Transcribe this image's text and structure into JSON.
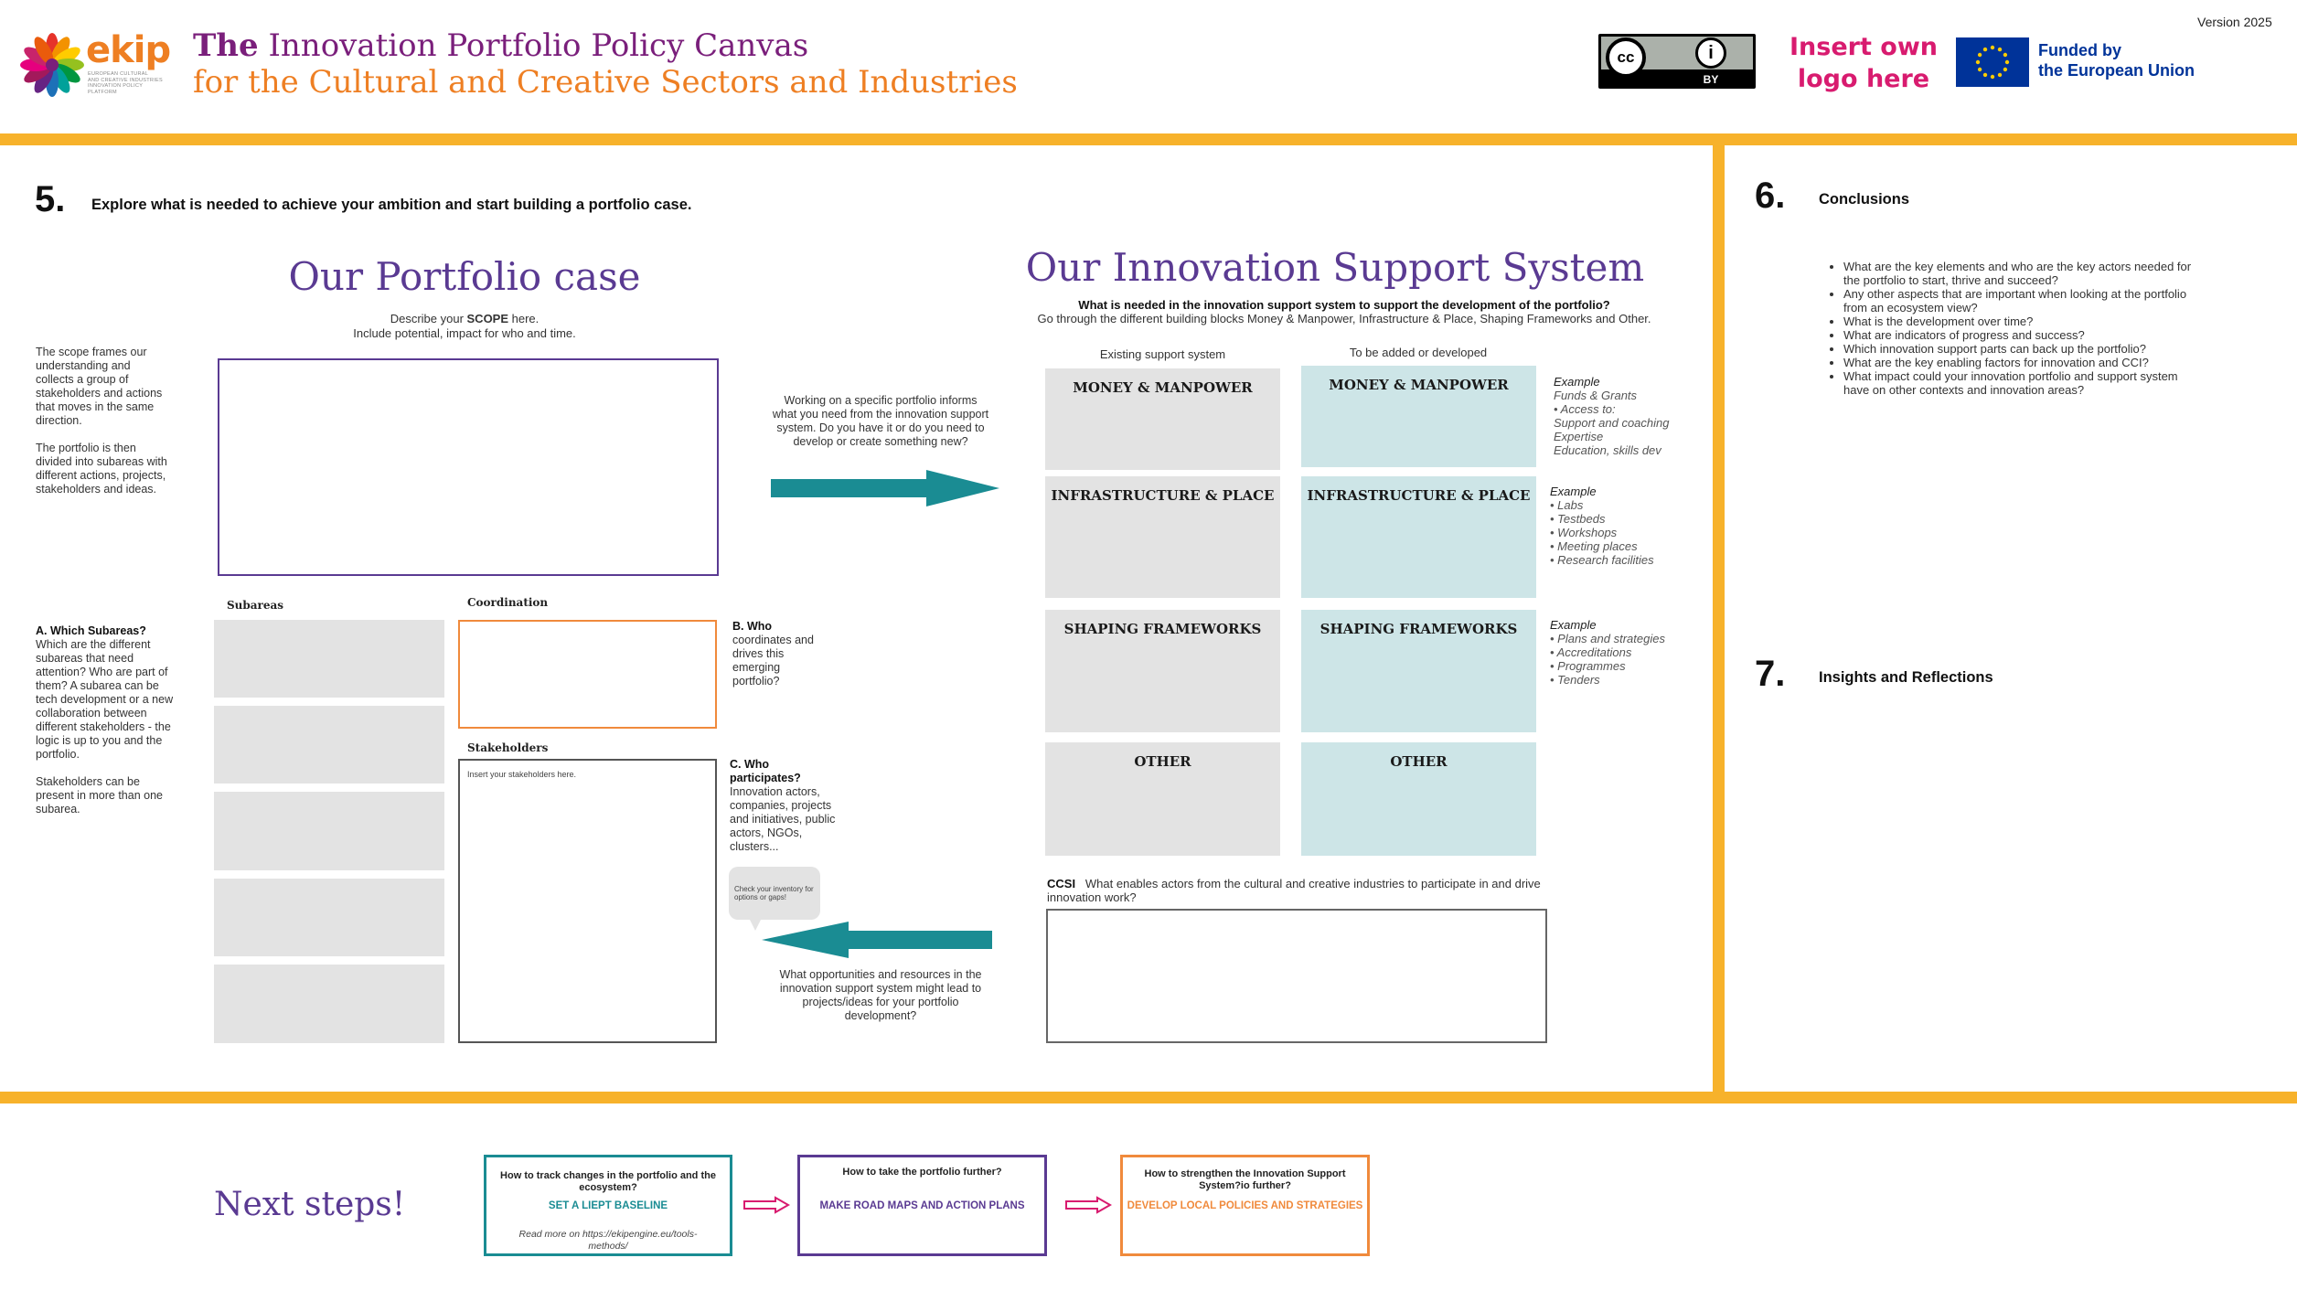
{
  "version": "Version 2025",
  "logo": {
    "name": "ekip",
    "tagline_lines": [
      "EUROPEAN CULTURAL",
      "AND CREATIVE INDUSTRIES",
      "INNOVATION POLICY PLATFORM"
    ]
  },
  "title": {
    "the": "The",
    "line1": "Innovation Portfolio Policy Canvas",
    "line2": "for the Cultural and Creative Sectors and Industries"
  },
  "license": {
    "label": "BY"
  },
  "own_logo": {
    "line1": "Insert own",
    "line2": "logo here"
  },
  "eu": {
    "line1": "Funded by",
    "line2": "the European Union"
  },
  "colors": {
    "yellow": "#F7B22B",
    "purple": "#5A3A92",
    "orange": "#F08A3C",
    "teal": "#1A8C93",
    "magenta": "#D81B6F",
    "title_purple": "#7A1F7B",
    "title_orange": "#EE7F23"
  },
  "section5": {
    "number": "5.",
    "heading": "Explore what is needed to achieve your ambition and start building a portfolio case.",
    "portfolio_title": "Our Portfolio case",
    "scope_pre": "Describe your ",
    "scope_bold": "SCOPE",
    "scope_post": " here.",
    "scope_line2": "Include potential, impact for who and time.",
    "left_text_1": "The scope frames our understanding and collects a group of stakeholders and actions that moves in the same direction.",
    "left_text_2": "The portfolio is then divided into subareas with different actions, projects, stakeholders and ideas.",
    "subareas_q_title": "A. Which Subareas?",
    "subareas_q_text": "Which are the different subareas that need attention? Who are part of them? A subarea can be tech development or a new collaboration between different stakeholders - the logic is up to you and the portfolio.",
    "subareas_q_text2": "Stakeholders can be present in more than one subarea.",
    "subareas_label": "Subareas",
    "coordination_label": "Coordination",
    "stakeholders_label": "Stakeholders",
    "stakeholders_placeholder": "Insert your stakeholders here.",
    "who_coord_title": "B. Who",
    "who_coord_text": "coordinates and drives this emerging portfolio?",
    "who_part_title": "C. Who participates?",
    "who_part_text": "Innovation actors, companies, projects and initiatives, public actors, NGOs, clusters...",
    "bubble": "Check your inventory for options or gaps!",
    "arrow_right_text": "Working on a specific portfolio informs what you need from the innovation support system.  Do you have it or do you need to develop or create something new?",
    "arrow_left_text": "What opportunities and resources in the innovation support system might lead to projects/ideas for your portfolio development?"
  },
  "iss": {
    "title": "Our Innovation Support System",
    "subtitle_bold": "What is needed in the innovation support system to support the development of the portfolio?",
    "subtitle": "Go through the different building blocks Money & Manpower, Infrastructure & Place, Shaping Frameworks and Other.",
    "col_existing": "Existing support system",
    "col_added": "To be added or developed",
    "blocks": [
      {
        "label": "MONEY & MANPOWER",
        "example_title": "Example",
        "example_lines": [
          "Funds & Grants",
          "• Access to:",
          "Support and coaching",
          "Expertise",
          "Education, skills dev"
        ]
      },
      {
        "label": "INFRASTRUCTURE & PLACE",
        "example_title": "Example",
        "example_lines": [
          "• Labs",
          "• Testbeds",
          "• Workshops",
          "• Meeting places",
          "• Research facilities"
        ]
      },
      {
        "label": "SHAPING FRAMEWORKS",
        "example_title": "Example",
        "example_lines": [
          "• Plans and strategies",
          "• Accreditations",
          "• Programmes",
          "• Tenders"
        ]
      },
      {
        "label": "OTHER",
        "example_title": "",
        "example_lines": []
      }
    ],
    "ccsi_label": "CCSI",
    "ccsi_text": "What enables actors from the cultural and creative industries to participate in and drive innovation work?"
  },
  "section6": {
    "number": "6.",
    "heading": "Conclusions",
    "bullets": [
      "What are the key elements and who are the key actors needed for the portfolio to start, thrive and succeed?",
      "Any other aspects that are important when looking at the portfolio from an ecosystem view?",
      "What is the development over time?",
      "What are indicators of progress and success?",
      "Which innovation support parts can back up the portfolio?",
      "What are the key enabling factors for innovation and CCI?",
      "What impact could your innovation portfolio and support system have on other contexts and innovation areas?"
    ]
  },
  "section7": {
    "number": "7.",
    "heading": "Insights and Reflections"
  },
  "next_steps": {
    "title": "Next steps!",
    "steps": [
      {
        "question": "How to track changes in the portfolio and the ecosystem?",
        "action": "SET A LIEPT BASELINE",
        "note": "Read more on https://ekipengine.eu/tools-methods/"
      },
      {
        "question": "How to take the portfolio further?",
        "action": "MAKE ROAD MAPS AND ACTION PLANS",
        "note": ""
      },
      {
        "question": "How to strengthen the Innovation Support System?io further?",
        "action": "DEVELOP LOCAL POLICIES AND STRATEGIES",
        "note": ""
      }
    ]
  }
}
